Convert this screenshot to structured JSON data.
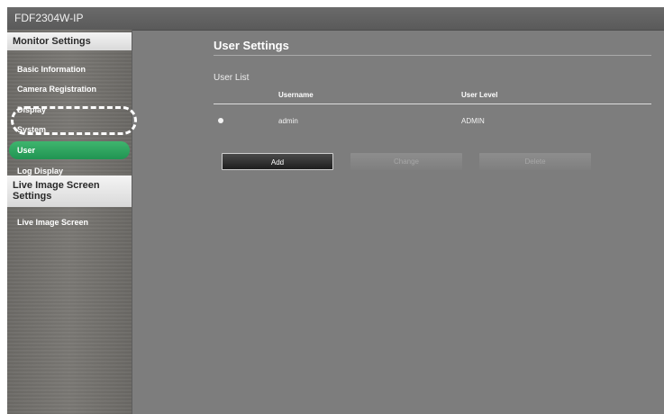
{
  "app": {
    "title": "FDF2304W-IP"
  },
  "sidebar": {
    "monitor_settings_header": "Monitor Settings",
    "items": [
      {
        "label": "Basic Information"
      },
      {
        "label": "Camera Registration"
      },
      {
        "label": "Display"
      },
      {
        "label": "System"
      },
      {
        "label": "User",
        "active": true
      },
      {
        "label": "Log Display"
      }
    ],
    "live_image_header": "Live Image Screen Settings",
    "live_items": [
      {
        "label": "Live Image Screen"
      }
    ]
  },
  "main": {
    "title": "User Settings",
    "user_list_label": "User List",
    "columns": {
      "username": "Username",
      "user_level": "User Level"
    },
    "rows": [
      {
        "username": "admin",
        "user_level": "ADMIN"
      }
    ],
    "buttons": {
      "add": "Add",
      "change": "Change",
      "delete": "Delete"
    }
  },
  "colors": {
    "active_item": "#2aa35d",
    "background": "#7d7d7d",
    "section_header": "#e6e6e6"
  }
}
